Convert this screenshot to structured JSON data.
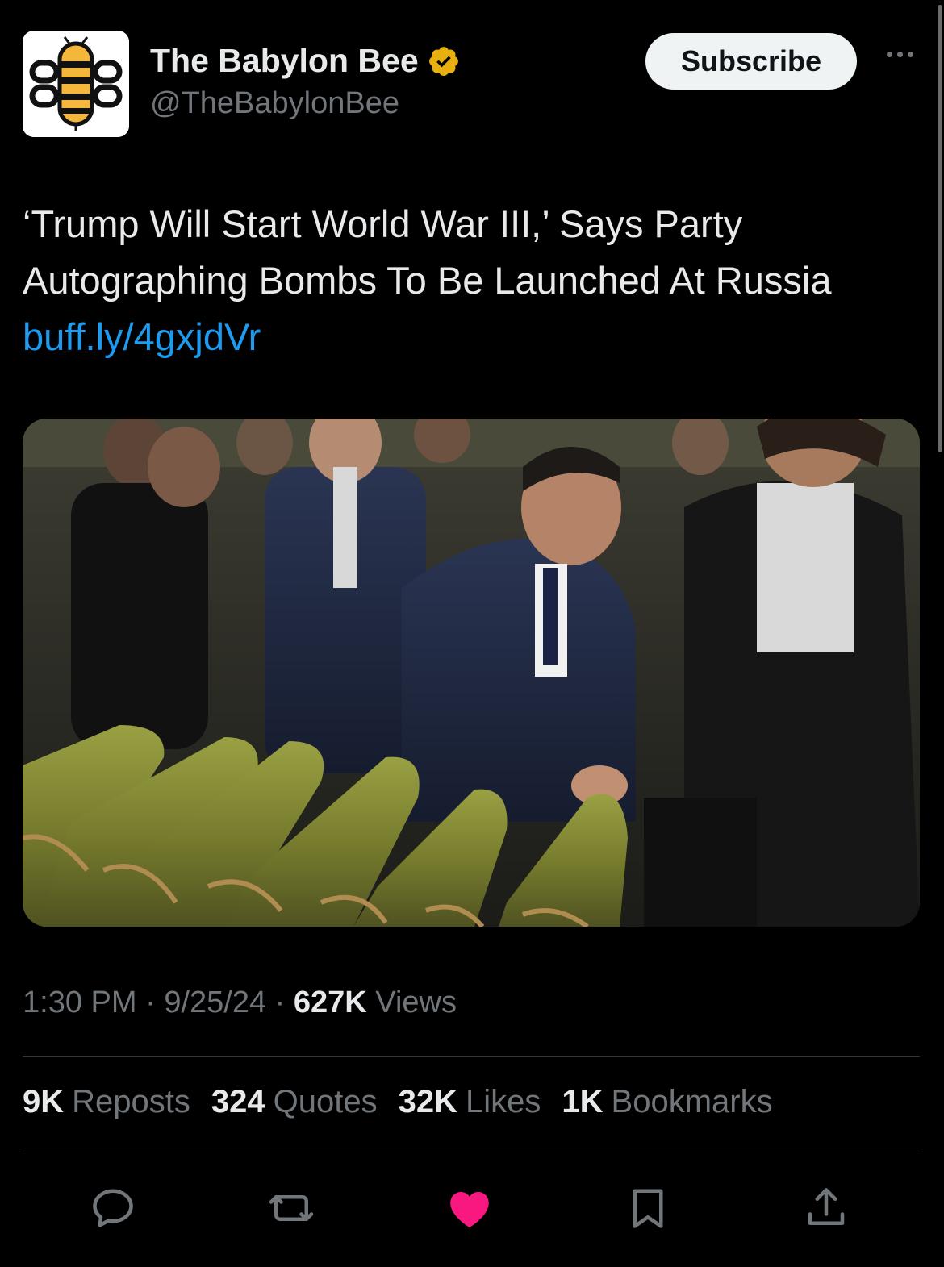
{
  "account": {
    "display_name": "The Babylon Bee",
    "handle": "@TheBabylonBee",
    "verified": true,
    "verified_color": "#e8b00f",
    "avatar_icon": "babylon-bee-logo"
  },
  "header": {
    "subscribe_label": "Subscribe",
    "more_icon": "more-horizontal-icon"
  },
  "post": {
    "text_line1": "‘Trump Will Start World War III,’ Says Party",
    "text_line2": "Autographing Bombs To Be Launched At Russia",
    "link": "buff.ly/4gxjdVr",
    "link_color": "#1d9bf0"
  },
  "meta": {
    "time": "1:30 PM",
    "date": "9/25/24",
    "views_count": "627K",
    "views_label": "Views"
  },
  "stats": [
    {
      "count": "9K",
      "label": "Reposts"
    },
    {
      "count": "324",
      "label": "Quotes"
    },
    {
      "count": "32K",
      "label": "Likes"
    },
    {
      "count": "1K",
      "label": "Bookmarks"
    }
  ],
  "actions": [
    {
      "icon": "reply-icon"
    },
    {
      "icon": "repost-icon"
    },
    {
      "icon": "like-icon",
      "active": true,
      "color": "#f91880"
    },
    {
      "icon": "bookmark-icon"
    },
    {
      "icon": "share-icon"
    }
  ]
}
